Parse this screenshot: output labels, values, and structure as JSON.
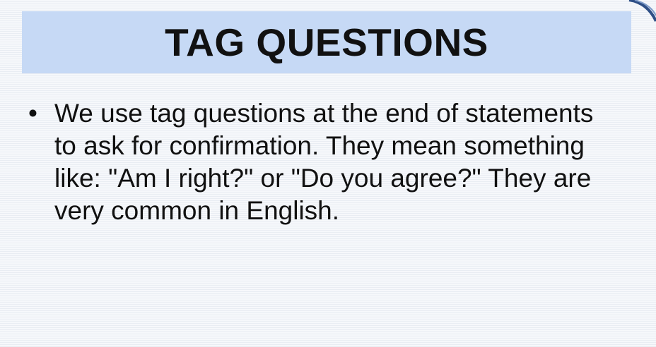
{
  "slide": {
    "title": "TAG QUESTIONS",
    "bullets": [
      {
        "marker": "•",
        "text": "We use tag questions at the end of statements to ask for confirmation. They mean something like: \"Am I right?\" or \"Do you agree?\" They are very common in English."
      }
    ]
  },
  "colors": {
    "title_background": "#c6d9f5",
    "text": "#111111",
    "corner_accent": "#3b5a8c"
  }
}
